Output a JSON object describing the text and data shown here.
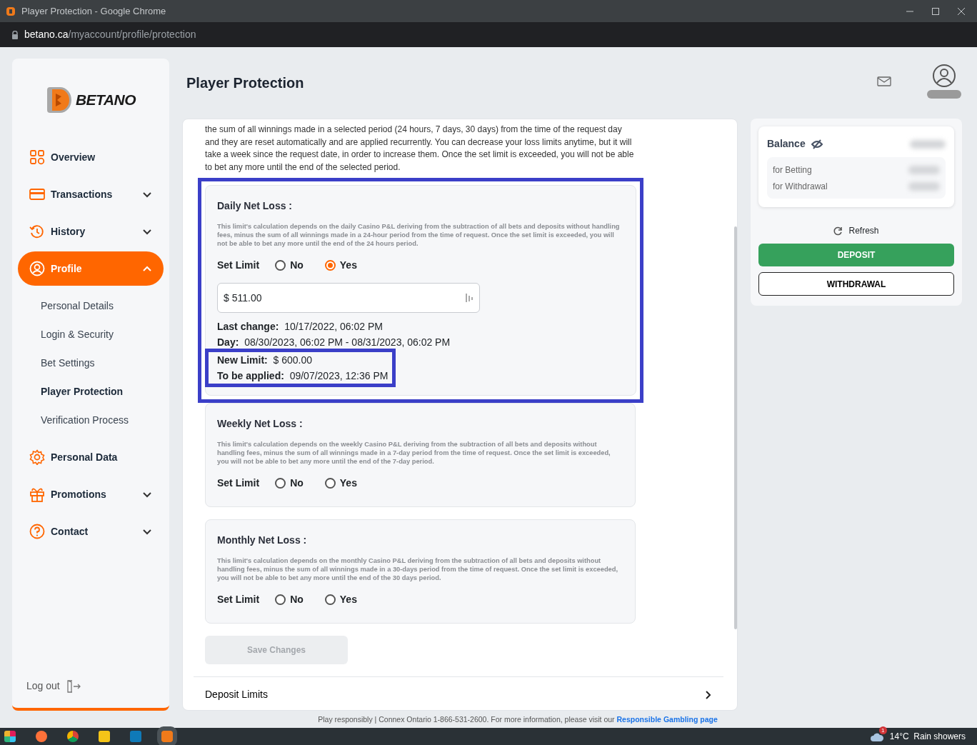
{
  "window": {
    "title": "Player Protection - Google Chrome"
  },
  "address_bar": {
    "domain": "betano.ca",
    "path": "/myaccount/profile/protection"
  },
  "sidebar": {
    "logo": "BETANO",
    "items": [
      {
        "label": "Overview",
        "kind": "plain",
        "selected": false
      },
      {
        "label": "Transactions",
        "kind": "expandable",
        "selected": false,
        "expanded": false
      },
      {
        "label": "History",
        "kind": "expandable",
        "selected": false,
        "expanded": false
      },
      {
        "label": "Profile",
        "kind": "expandable",
        "selected": true,
        "expanded": true,
        "children": [
          {
            "label": "Personal Details",
            "selected": false
          },
          {
            "label": "Login & Security",
            "selected": false
          },
          {
            "label": "Bet Settings",
            "selected": false
          },
          {
            "label": "Player Protection",
            "selected": true
          },
          {
            "label": "Verification Process",
            "selected": false
          }
        ]
      },
      {
        "label": "Personal Data",
        "kind": "plain",
        "selected": false
      },
      {
        "label": "Promotions",
        "kind": "expandable",
        "selected": false,
        "expanded": false
      },
      {
        "label": "Contact",
        "kind": "expandable",
        "selected": false,
        "expanded": false
      }
    ],
    "logout": "Log out"
  },
  "page": {
    "title": "Player Protection"
  },
  "intro": "the sum of all winnings made  in a selected period (24 hours, 7 days, 30 days) from the time of the request day and they are reset automatically and are applied recurrently. You can decrease your loss limits anytime, but it will take a week since the request date, in order to increase them. Once the set limit is exceeded, you will not be able to bet any more until the end of the selected period.",
  "limits": [
    {
      "title": "Daily Net Loss :",
      "highlighted": true,
      "description": "This limit's calculation depends on the daily Casino P&L deriving from the subtraction of all bets and deposits without handling fees, minus the sum of all winnings made in a 24-hour period from the time of request. Once the set limit is exceeded, you will not be able to bet any more until the end of the 24 hours period.",
      "set_limit_label": "Set Limit",
      "options": [
        {
          "label": "No",
          "selected": false
        },
        {
          "label": "Yes",
          "selected": true
        }
      ],
      "amount": "$ 511.00",
      "details": [
        {
          "label": "Last change:",
          "value": "10/17/2022, 06:02 PM"
        },
        {
          "label": "Day:",
          "value": "08/30/2023, 06:02 PM - 08/31/2023, 06:02 PM"
        }
      ],
      "pending": {
        "highlighted": true,
        "details": [
          {
            "label": "New Limit:",
            "value": "$ 600.00"
          },
          {
            "label": "To be applied:",
            "value": "09/07/2023, 12:36 PM"
          }
        ]
      }
    },
    {
      "title": "Weekly Net Loss :",
      "highlighted": false,
      "description": "This limit's calculation depends on the weekly Casino P&L deriving from the subtraction of all bets and deposits without handling fees, minus the sum of all winnings made in a 7-day period from the time of request. Once the set limit is exceeded, you will not be able to bet any more until the end of the 7-day period.",
      "set_limit_label": "Set Limit",
      "options": [
        {
          "label": "No",
          "selected": false
        },
        {
          "label": "Yes",
          "selected": false
        }
      ]
    },
    {
      "title": "Monthly Net Loss :",
      "highlighted": false,
      "description": "This limit's calculation depends on the monthly Casino P&L deriving from the subtraction of all bets and deposits without handling fees, minus the sum of all winnings made in a 30-days period from the time of request. Once the set limit is exceeded, you will not be able to bet any more until the end of the 30 days period.",
      "set_limit_label": "Set Limit",
      "options": [
        {
          "label": "No",
          "selected": false
        },
        {
          "label": "Yes",
          "selected": false
        }
      ]
    }
  ],
  "save_button": {
    "label": "Save Changes",
    "disabled": true
  },
  "collapsed_sections": [
    {
      "label": "Deposit Limits"
    }
  ],
  "footer": {
    "text": "Play responsibly | Connex Ontario 1-866-531-2600. For more information, please visit our",
    "link": "Responsible Gambling page"
  },
  "balance": {
    "title": "Balance",
    "rows": [
      "for Betting",
      "for Withdrawal"
    ],
    "refresh": "Refresh",
    "deposit": "DEPOSIT",
    "withdrawal": "WITHDRAWAL"
  },
  "taskbar": {
    "weather": "14°C  Rain showers",
    "notification_badge": "1"
  }
}
